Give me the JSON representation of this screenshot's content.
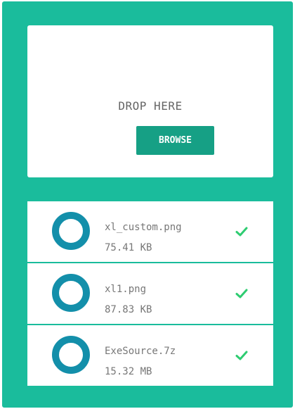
{
  "drop_zone": {
    "text": "DROP HERE",
    "button_label": "BROWSE"
  },
  "files": [
    {
      "name": "xl_custom.png",
      "size": "75.41 KB",
      "status_icon": "check-icon"
    },
    {
      "name": "xl1.png",
      "size": "87.83 KB",
      "status_icon": "check-icon"
    },
    {
      "name": "ExeSource.7z",
      "size": "15.32 MB",
      "status_icon": "check-icon"
    }
  ],
  "colors": {
    "background": "#1abc9c",
    "button": "#16a085",
    "progress_ring": "#138faa",
    "check": "#2ecc71"
  }
}
